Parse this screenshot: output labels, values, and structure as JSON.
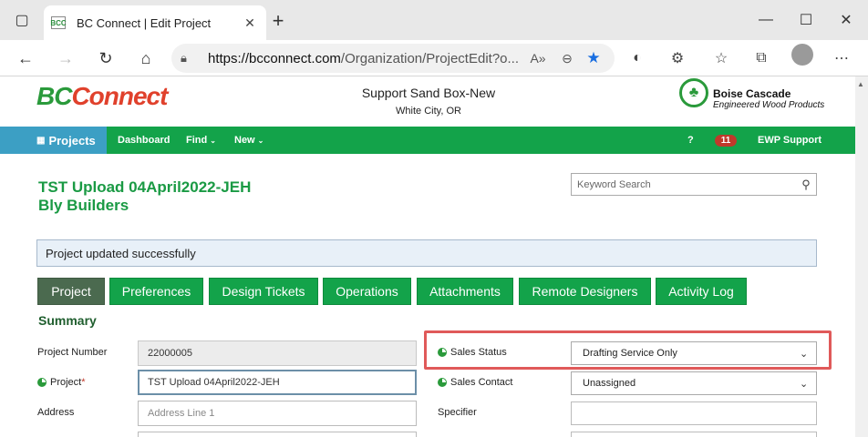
{
  "browser": {
    "tab_title": "BC Connect | Edit Project",
    "tab_favicon": "BCC",
    "url_domain": "https://bcconnect.com",
    "url_path": "/Organization/ProjectEdit?o..."
  },
  "header": {
    "logo_bc": "BC",
    "logo_connect": "Connect",
    "org_name": "Support Sand Box-New",
    "org_location": "White City, OR",
    "partner_name": "Boise Cascade",
    "partner_sub": "Engineered Wood Products"
  },
  "nav": {
    "projects": "Projects",
    "dashboard": "Dashboard",
    "find": "Find",
    "new": "New",
    "help": "?",
    "notification_count": "11",
    "user": "EWP Support"
  },
  "project": {
    "title": "TST Upload 04April2022-JEH",
    "builder": "Bly Builders"
  },
  "search": {
    "placeholder": "Keyword Search"
  },
  "alert": {
    "message": "Project updated successfully"
  },
  "tabs": [
    {
      "label": "Project"
    },
    {
      "label": "Preferences"
    },
    {
      "label": "Design Tickets"
    },
    {
      "label": "Operations"
    },
    {
      "label": "Attachments"
    },
    {
      "label": "Remote Designers"
    },
    {
      "label": "Activity Log"
    }
  ],
  "summary": {
    "title": "Summary",
    "project_number_label": "Project Number",
    "project_number": "22000005",
    "project_label": "Project",
    "required_mark": "*",
    "project_value": "TST Upload 04April2022-JEH",
    "address_label": "Address",
    "address_placeholder": "Address Line 1",
    "sales_status_label": "Sales Status",
    "sales_status_value": "Drafting Service Only",
    "sales_contact_label": "Sales Contact",
    "sales_contact_value": "Unassigned",
    "specifier_label": "Specifier"
  },
  "colors": {
    "brand_green": "#13a34a",
    "projects_blue": "#3c9fc4",
    "active_tab": "#4b6a4f",
    "highlight_red": "#e05a5a"
  }
}
